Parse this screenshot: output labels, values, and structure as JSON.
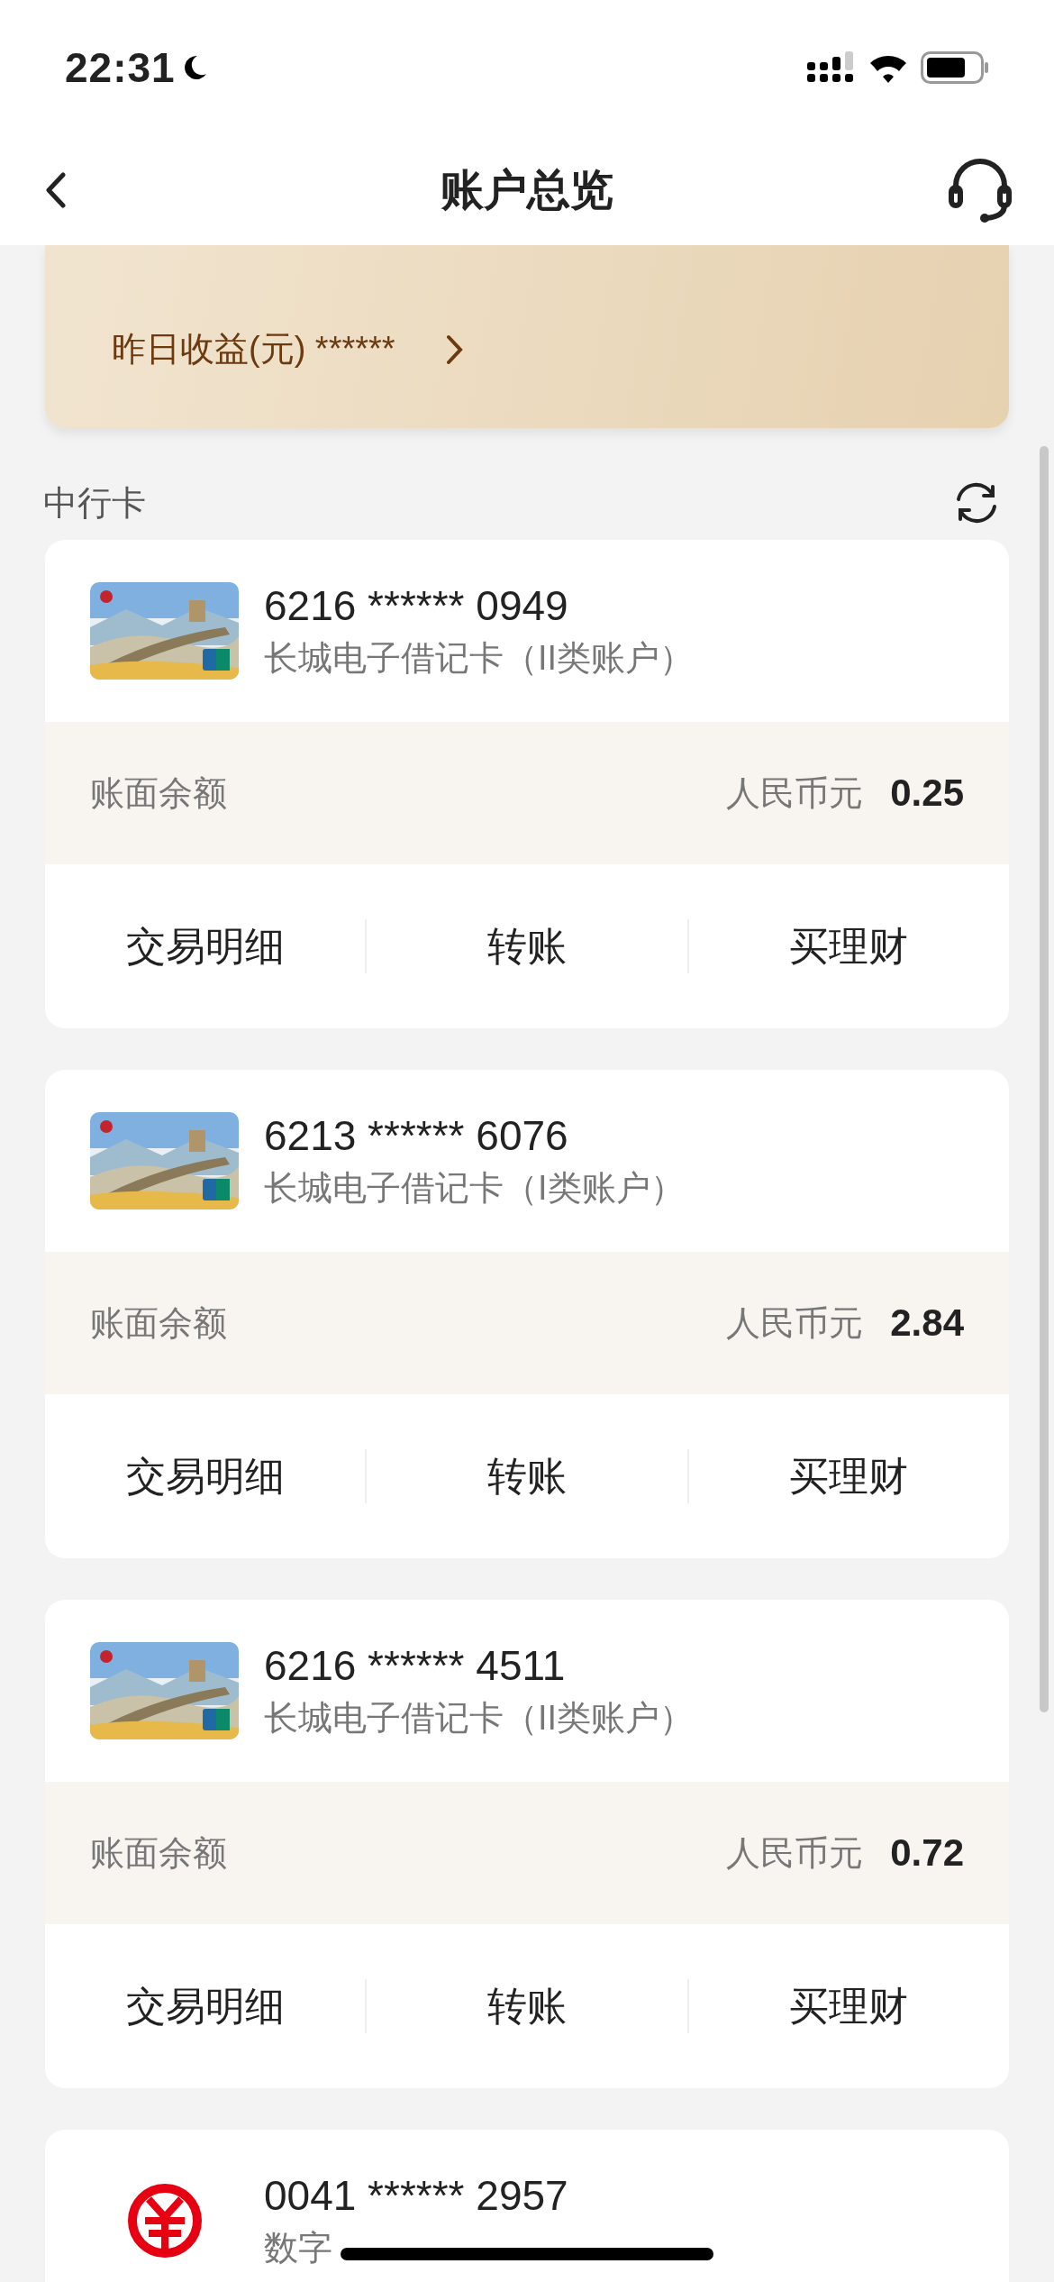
{
  "status_bar": {
    "time": "22:31"
  },
  "nav": {
    "title": "账户总览"
  },
  "earnings": {
    "label": "昨日收益(元) ******"
  },
  "section": {
    "title": "中行卡"
  },
  "accounts": [
    {
      "kind": "debit_card",
      "number": "6216 ****** 0949",
      "type": "长城电子借记卡（II类账户）",
      "balance_label": "账面余额",
      "currency": "人民币元",
      "balance": "0.25",
      "actions": [
        "交易明细",
        "转账",
        "买理财"
      ]
    },
    {
      "kind": "debit_card",
      "number": "6213 ****** 6076",
      "type": "长城电子借记卡（I类账户）",
      "balance_label": "账面余额",
      "currency": "人民币元",
      "balance": "2.84",
      "actions": [
        "交易明细",
        "转账",
        "买理财"
      ]
    },
    {
      "kind": "debit_card",
      "number": "6216 ****** 4511",
      "type": "长城电子借记卡（II类账户）",
      "balance_label": "账面余额",
      "currency": "人民币元",
      "balance": "0.72",
      "actions": [
        "交易明细",
        "转账",
        "买理财"
      ]
    },
    {
      "kind": "wallet",
      "number": "0041 ****** 2957",
      "type": "数字"
    }
  ]
}
